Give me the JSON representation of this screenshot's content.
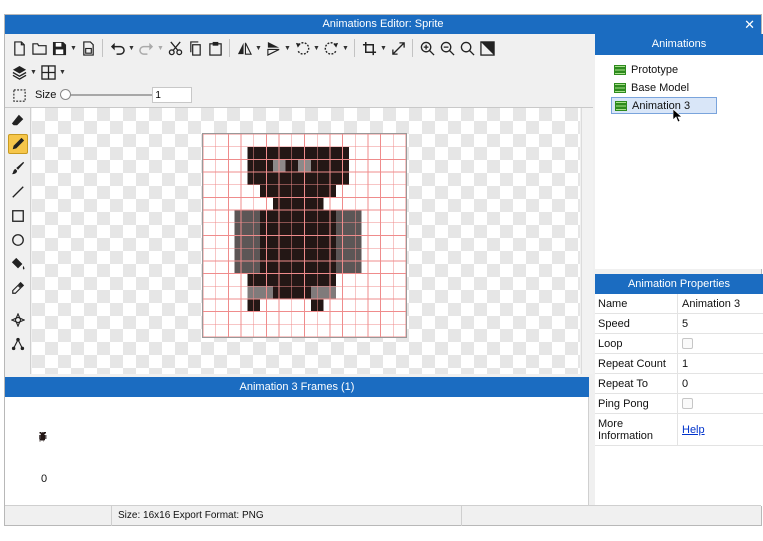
{
  "window": {
    "title": "Animations Editor: Sprite",
    "close_glyph": "✕"
  },
  "toolbar": {
    "size_label": "Size",
    "size_value": "1",
    "size_level": 0.0,
    "row1_icons": [
      "new-file-icon",
      "open-folder-icon",
      "save-icon",
      "save-as-icon",
      "undo-icon",
      "redo-icon",
      "cut-icon",
      "copy-icon",
      "paste-icon",
      "flip-horizontal-icon",
      "flip-vertical-icon",
      "rotate-left-icon",
      "rotate-right-icon",
      "crop-icon",
      "resize-icon",
      "zoom-in-icon",
      "zoom-out-icon",
      "zoom-fit-icon",
      "fullscreen-icon"
    ],
    "row2_icons": [
      "layers-icon",
      "grid-icon"
    ]
  },
  "tools": [
    "eraser-icon",
    "pencil-icon",
    "brush-icon",
    "line-icon",
    "rectangle-icon",
    "ellipse-icon",
    "fill-bucket-icon",
    "eyedropper-icon",
    "move-icon",
    "pivot-icon"
  ],
  "animations": {
    "header": "Animations",
    "items": [
      {
        "label": "Prototype",
        "selected": false
      },
      {
        "label": "Base Model",
        "selected": false
      },
      {
        "label": "Animation 3",
        "selected": true
      }
    ]
  },
  "properties": {
    "header": "Animation Properties",
    "rows": [
      {
        "name": "Name",
        "value": "Animation 3",
        "type": "text"
      },
      {
        "name": "Speed",
        "value": "5",
        "type": "text"
      },
      {
        "name": "Loop",
        "value": "",
        "type": "checkbox",
        "checked": false
      },
      {
        "name": "Repeat Count",
        "value": "1",
        "type": "text"
      },
      {
        "name": "Repeat To",
        "value": "0",
        "type": "text"
      },
      {
        "name": "Ping Pong",
        "value": "",
        "type": "checkbox",
        "checked": false
      },
      {
        "name": "More Information",
        "value": "Help",
        "type": "link"
      }
    ]
  },
  "frames": {
    "header": "Animation 3 Frames (1)",
    "items": [
      {
        "index": "0"
      }
    ]
  },
  "status": {
    "info": "Size: 16x16   Export Format: PNG"
  },
  "colors": {
    "accent": "#1b6cc1",
    "grid_line": "#ef8c8c",
    "body": "#231715",
    "arms": "#5c5656",
    "legs": "#807b7b",
    "eyes": "#8d8989"
  }
}
